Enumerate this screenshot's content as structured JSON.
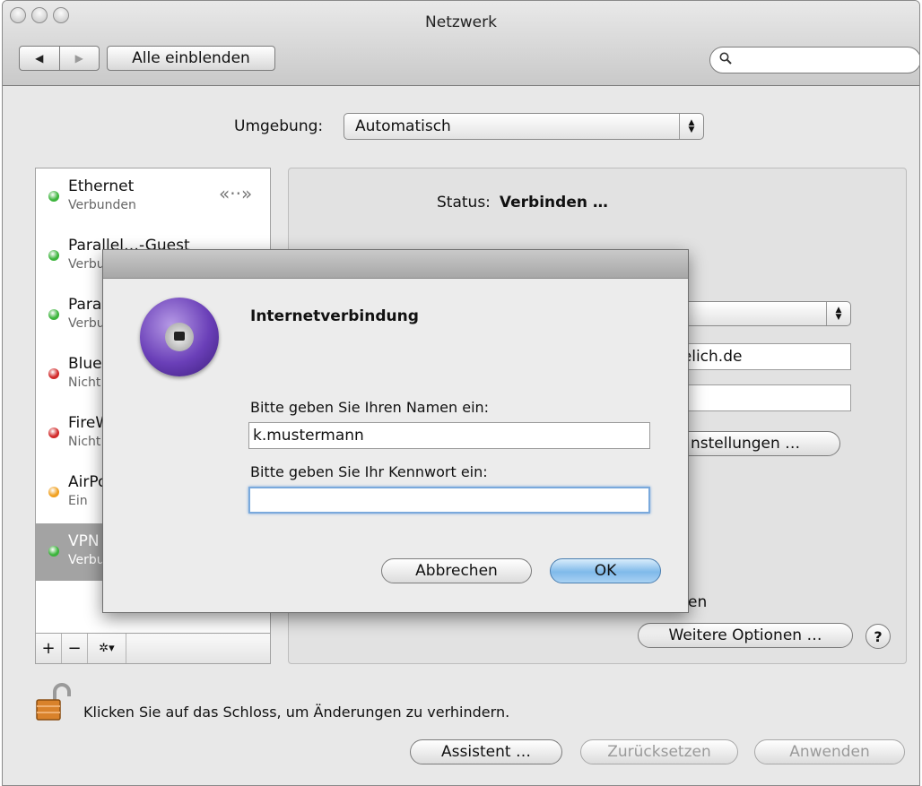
{
  "window": {
    "title": "Netzwerk"
  },
  "toolbar": {
    "back": "◀",
    "forward": "▶",
    "show_all": "Alle einblenden",
    "search_placeholder": ""
  },
  "location": {
    "label": "Umgebung:",
    "value": "Automatisch"
  },
  "services": [
    {
      "name": "Ethernet",
      "state": "Verbunden",
      "color": "#3cb43c"
    },
    {
      "name": "Parallel…-Guest",
      "state": "Verbunden",
      "color": "#3cb43c"
    },
    {
      "name": "Parallels",
      "state": "Verbunden",
      "color": "#3cb43c"
    },
    {
      "name": "Bluetooth",
      "state": "Nicht verbunden",
      "color": "#d12a2a"
    },
    {
      "name": "FireWire",
      "state": "Nicht verbunden",
      "color": "#d12a2a"
    },
    {
      "name": "AirPort",
      "state": "Ein",
      "color": "#f0a020"
    },
    {
      "name": "VPN",
      "state": "Verbunden",
      "color": "#3cb43c"
    }
  ],
  "sidebar_footer": {
    "add": "+",
    "remove": "−",
    "gear": "✲▾"
  },
  "panel": {
    "status_label": "Status:",
    "status_value": "Verbinden …",
    "server_partial": "uelich.de",
    "auth_settings_partial": "nstellungen …",
    "checkbox_partial": "en",
    "more_options": "Weitere Optionen …",
    "help": "?"
  },
  "lock_text": "Klicken Sie auf das Schloss, um Änderungen zu verhindern.",
  "bottom_buttons": {
    "assistant": "Assistent …",
    "revert": "Zurücksetzen",
    "apply": "Anwenden"
  },
  "dialog": {
    "title": "Internetverbindung",
    "name_label": "Bitte geben Sie Ihren Namen ein:",
    "name_value": "k.mustermann",
    "password_label": "Bitte geben Sie Ihr Kennwort ein:",
    "password_value": "",
    "cancel": "Abbrechen",
    "ok": "OK"
  }
}
